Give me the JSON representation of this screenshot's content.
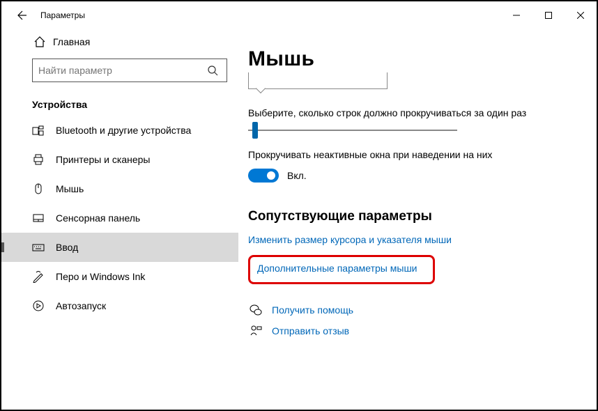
{
  "window": {
    "title": "Параметры"
  },
  "sidebar": {
    "home_label": "Главная",
    "search_placeholder": "Найти параметр",
    "category": "Устройства",
    "items": [
      {
        "label": "Bluetooth и другие устройства"
      },
      {
        "label": "Принтеры и сканеры"
      },
      {
        "label": "Мышь"
      },
      {
        "label": "Сенсорная панель"
      },
      {
        "label": "Ввод"
      },
      {
        "label": "Перо и Windows Ink"
      },
      {
        "label": "Автозапуск"
      }
    ]
  },
  "main": {
    "title": "Мышь",
    "scroll_lines_label": "Выберите, сколько строк должно прокручиваться за один раз",
    "inactive_scroll_label": "Прокручивать неактивные окна при наведении на них",
    "toggle_on_label": "Вкл.",
    "related_heading": "Сопутствующие параметры",
    "link_cursor_size": "Изменить размер курсора и указателя мыши",
    "link_advanced": "Дополнительные параметры мыши",
    "help_label": "Получить помощь",
    "feedback_label": "Отправить отзыв"
  }
}
